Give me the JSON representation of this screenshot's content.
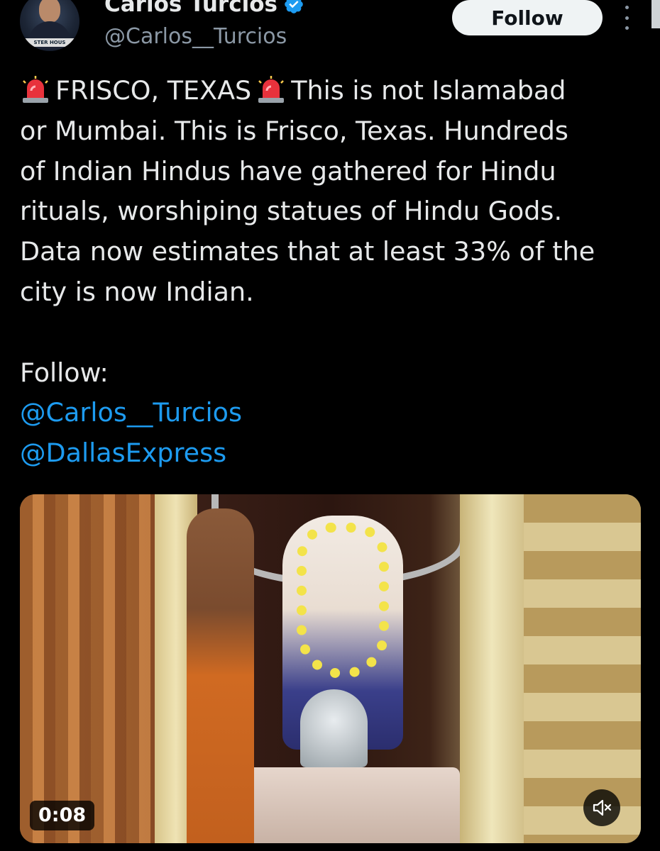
{
  "author": {
    "name": "Carlos Turcios",
    "handle": "@Carlos__Turcios",
    "avatar_banner_text": "STER HOUS",
    "verified_icon": "verified-badge-icon"
  },
  "header": {
    "follow_label": "Follow",
    "more_icon": "more-options-icon"
  },
  "tweet": {
    "lines": [
      "FRISCO, TEXAS",
      "This is not Islamabad",
      "or Mumbai. This is Frisco, Texas. Hundreds",
      "of Indian Hindus have gathered for Hindu",
      "rituals, worshiping statues of Hindu Gods.",
      "Data now estimates that at least 33% of the",
      "city is now Indian.",
      "Follow:"
    ],
    "mentions": [
      "@Carlos__Turcios",
      "@DallasExpress"
    ],
    "siren_icon": "police-siren-emoji-icon"
  },
  "media": {
    "duration": "0:08",
    "mute_icon": "speaker-muted-icon"
  },
  "colors": {
    "background": "#000000",
    "text": "#e7e9ea",
    "secondary_text": "#8b98a5",
    "link": "#1d9bf0",
    "verified": "#1d9bf0",
    "follow_button_bg": "#eff3f4"
  }
}
